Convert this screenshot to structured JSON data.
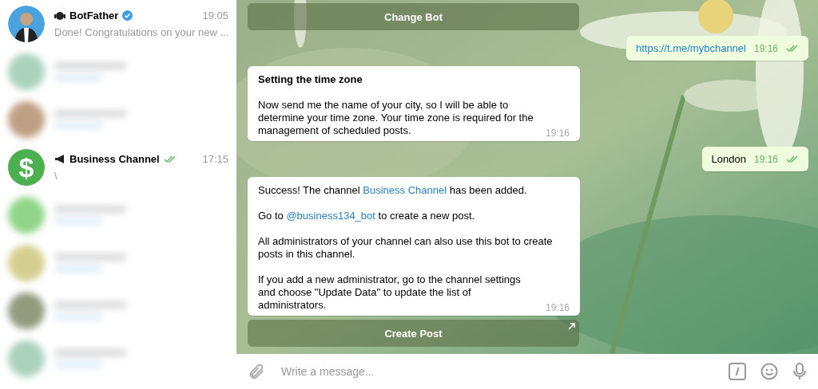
{
  "sidebar": {
    "chats": [
      {
        "kind": "chat",
        "name": "BotFather",
        "bot": true,
        "verified": true,
        "channel": false,
        "time": "19:05",
        "read": false,
        "preview": "Done! Congratulations on your new ..."
      },
      {
        "kind": "blurred"
      },
      {
        "kind": "blurred"
      },
      {
        "kind": "chat",
        "avatar_symbol": "$",
        "name": "Business Channel",
        "bot": false,
        "verified": false,
        "channel": true,
        "time": "17:15",
        "read": true,
        "preview": "\\"
      },
      {
        "kind": "blurred"
      },
      {
        "kind": "blurred"
      },
      {
        "kind": "blurred"
      },
      {
        "kind": "blurred"
      }
    ]
  },
  "messages": [
    {
      "kind": "button",
      "label": "Change Bot",
      "url": false
    },
    {
      "kind": "outgoing",
      "segments": [
        {
          "kind": "link",
          "text": "https://t.me/mybchannel"
        }
      ],
      "time": "19:16",
      "read": true
    },
    {
      "kind": "incoming",
      "title": "Setting the time zone",
      "paragraphs": [
        [
          {
            "kind": "text",
            "text": "Now send me the name of your city, so I will be able to determine your time zone. Your time zone is required for the management of scheduled posts."
          }
        ]
      ],
      "time": "19:16"
    },
    {
      "kind": "outgoing",
      "segments": [
        {
          "kind": "text",
          "text": "London"
        }
      ],
      "time": "19:16",
      "read": true
    },
    {
      "kind": "incoming",
      "paragraphs": [
        [
          {
            "kind": "text",
            "text": "Success! The channel "
          },
          {
            "kind": "link",
            "text": "Business Channel"
          },
          {
            "kind": "text",
            "text": " has been added."
          }
        ],
        [
          {
            "kind": "text",
            "text": "Go to "
          },
          {
            "kind": "link",
            "text": "@business134_bot"
          },
          {
            "kind": "text",
            "text": " to create a new post."
          }
        ],
        [
          {
            "kind": "text",
            "text": "All administrators of your channel can also use this bot to create posts in this channel."
          }
        ],
        [
          {
            "kind": "text",
            "text": "If you add a new administrator, go to the channel settings and choose \"Update Data\" to update the list of administrators."
          }
        ]
      ],
      "time": "19:16"
    },
    {
      "kind": "button",
      "label": "Create Post",
      "url": true
    }
  ],
  "composer": {
    "placeholder": "Write a message..."
  }
}
